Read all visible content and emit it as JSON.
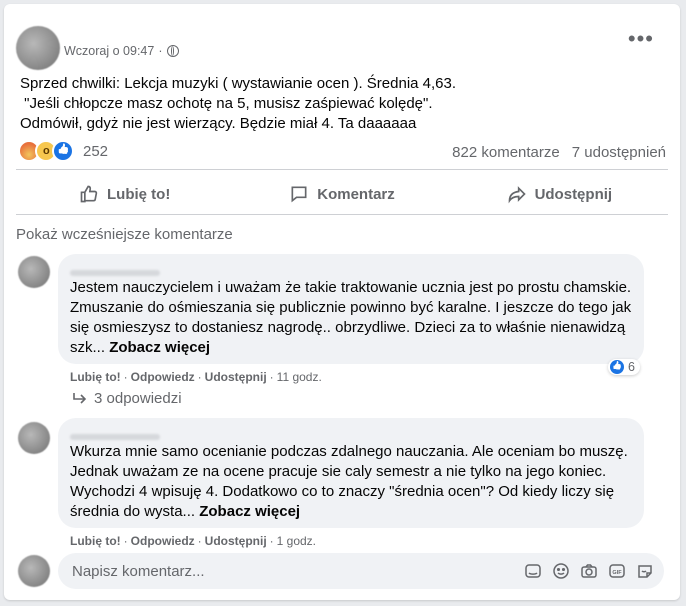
{
  "post": {
    "timestamp": "Wczoraj o 09:47",
    "dot": "·",
    "text_lines": [
      "Sprzed chwilki: Lekcja muzyki ( wystawianie ocen ). Średnia 4,63.",
      " \"Jeśli chłopcze masz ochotę na 5, musisz zaśpiewać kolędę\".",
      "Odmówił, gdyż nie jest wierzący. Będzie miał 4. Ta daaaaaa"
    ],
    "reaction_count": "252",
    "comments_count": "822 komentarze",
    "shares_count": "7 udostępnień"
  },
  "actions": {
    "like": "Lubię to!",
    "comment": "Komentarz",
    "share": "Udostępnij"
  },
  "show_previous": "Pokaż wcześniejsze komentarze",
  "comments": [
    {
      "lines": [
        "Jestem nauczycielem i uważam że takie traktowanie ucznia jest po prostu chamskie.",
        "Zmuszanie do ośmieszania się publicznie powinno być karalne. I jeszcze do tego jak",
        "się osmieszysz to dostaniesz nagrodę.. obrzydliwe. Dzieci za to właśnie nienawidzą",
        "szk..."
      ],
      "see_more": "Zobacz więcej",
      "like": "Lubię to!",
      "reply": "Odpowiedz",
      "share": "Udostępnij",
      "time": "11 godz.",
      "reaction_count": "6",
      "replies": "3 odpowiedzi"
    },
    {
      "lines": [
        "Wkurza mnie samo ocenianie podczas zdalnego nauczania. Ale oceniam bo muszę.",
        "Jednak uważam ze na ocene pracuje sie caly semestr a nie tylko na jego koniec.",
        "Wychodzi 4 wpisuję 4. Dodatkowo co to znaczy \"średnia ocen\"? Od kiedy liczy się",
        "średnia do wysta..."
      ],
      "see_more": "Zobacz więcej",
      "like": "Lubię to!",
      "reply": "Odpowiedz",
      "share": "Udostępnij",
      "time": "1 godz."
    }
  ],
  "composer": {
    "placeholder": "Napisz komentarz..."
  },
  "icons": [
    "globe-icon",
    "more-options-icon",
    "angry-reaction-icon",
    "wow-reaction-icon",
    "like-reaction-icon",
    "like-icon",
    "comment-icon",
    "share-icon",
    "reply-arrow-icon",
    "sticker-icon",
    "emoji-icon",
    "camera-icon",
    "gif-icon",
    "avatar-sticker-icon"
  ],
  "colors": {
    "accent": "#1b74e4",
    "secondary_text": "#65676b",
    "bubble": "#f0f2f5"
  }
}
